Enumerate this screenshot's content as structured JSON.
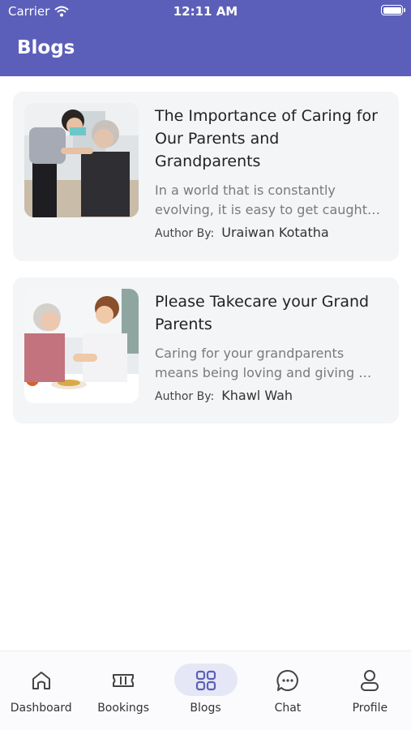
{
  "status_bar": {
    "carrier": "Carrier",
    "time": "12:11 AM"
  },
  "header": {
    "title": "Blogs"
  },
  "blogs": [
    {
      "title": "The Importance of Caring for Our Parents and Grandparents",
      "excerpt": "In a world that is constantly evolving, it is easy to get caught…",
      "author_label": "Author By:",
      "author": "Uraiwan Kotatha"
    },
    {
      "title": "Please Takecare your Grand Parents",
      "excerpt": "Caring for your grandparents means being loving and giving …",
      "author_label": "Author By:",
      "author": "Khawl Wah"
    }
  ],
  "tabs": [
    {
      "label": "Dashboard",
      "icon": "home-icon"
    },
    {
      "label": "Bookings",
      "icon": "ticket-icon"
    },
    {
      "label": "Blogs",
      "icon": "grid-icon",
      "active": true
    },
    {
      "label": "Chat",
      "icon": "chat-bubble-icon"
    },
    {
      "label": "Profile",
      "icon": "user-icon"
    }
  ],
  "colors": {
    "header": "#5c5fb9",
    "accent": "#5c5fb9",
    "card": "#f4f5f7"
  }
}
